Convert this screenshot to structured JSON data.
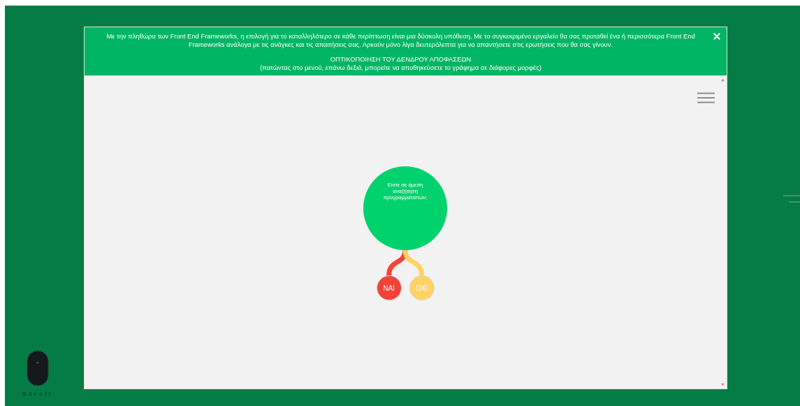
{
  "banner": {
    "intro": "Με την πληθώρα των Front End Frameworks, η επιλογή για το καταλληλότερο σε κάθε περίπτωση είναι μια δύσκολη υπόθεση. Με το συγκεκριμένο εργαλείο θα σας προταθεί ένα ή περισσότερα Front End Frameworks ανάλογα με τις ανάγκες και τις απαιτήσεις σας. Αρκούν μόνο λίγα δευτερόλεπτα για να απαντήσετε στις ερωτήσεις που θα σας γίνουν.",
    "title": "ΟΠΤΙΚΟΠΟΙΗΣΗ ΤΟΥ ΔΕΝΔΡΟΥ ΑΠΟΦΑΣΕΩΝ",
    "subtitle": "(πατώντας στο μενού, επάνω δεξιά, μπορείτε να αποθηκεύσετε το γράφημα σε διάφορες μορφές)"
  },
  "tree": {
    "question": "Είστε σε άμεση αναζήτηση προγραμματιστών;",
    "color": "#00d26e",
    "children": [
      {
        "label": "ΝΑΙ",
        "color": "#f44336"
      },
      {
        "label": "ΟΧΙ",
        "color": "#ffd263"
      }
    ]
  },
  "scroll_hint": "Scroll"
}
